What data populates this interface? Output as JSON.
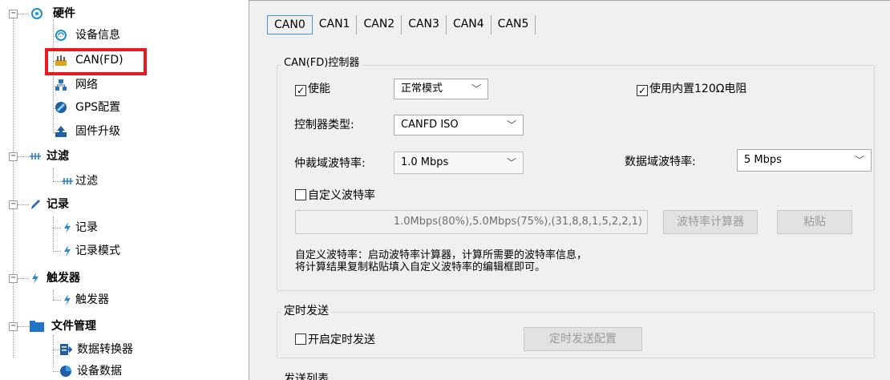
{
  "tree": {
    "nodes": [
      {
        "label": "硬件",
        "icon": "hardware-icon"
      },
      {
        "label": "设备信息",
        "icon": "device-info-icon"
      },
      {
        "label": "CAN(FD)",
        "icon": "can-icon"
      },
      {
        "label": "网络",
        "icon": "network-icon"
      },
      {
        "label": "GPS配置",
        "icon": "gps-icon"
      },
      {
        "label": "固件升级",
        "icon": "firmware-upgrade-icon"
      },
      {
        "label": "过滤",
        "icon": "filter-icon"
      },
      {
        "label": "过滤",
        "icon": "filter-icon"
      },
      {
        "label": "记录",
        "icon": "pencil-icon"
      },
      {
        "label": "记录",
        "icon": "lightning-icon"
      },
      {
        "label": "记录模式",
        "icon": "lightning-icon"
      },
      {
        "label": "触发器",
        "icon": "lightning-icon"
      },
      {
        "label": "触发器",
        "icon": "lightning-icon"
      },
      {
        "label": "文件管理",
        "icon": "folder-icon"
      },
      {
        "label": "数据转换器",
        "icon": "data-converter-icon"
      },
      {
        "label": "设备数据",
        "icon": "device-data-icon"
      }
    ],
    "highlight_color": "#e8191f"
  },
  "tabs": [
    "CAN0",
    "CAN1",
    "CAN2",
    "CAN3",
    "CAN4",
    "CAN5"
  ],
  "controller": {
    "title": "CAN(FD)控制器",
    "enable_label": "使能",
    "mode_value": "正常模式",
    "resistor_label": "使用内置120Ω电阻",
    "type_label": "控制器类型:",
    "type_value": "CANFD ISO",
    "arb_label": "仲裁域波特率:",
    "arb_value": "1.0 Mbps",
    "data_label": "数据域波特率:",
    "data_value": "5 Mbps",
    "custom_label": "自定义波特率",
    "custom_value": "1.0Mbps(80%),5.0Mbps(75%),(31,8,8,1,5,2,2,1)",
    "calc_button": "波特率计算器",
    "paste_button": "粘贴",
    "note_line1": "自定义波特率：启动波特率计算器，计算所需要的波特率信息，",
    "note_line2": "将计算结果复制粘贴填入自定义波特率的编辑框即可。"
  },
  "timer": {
    "title": "定时发送",
    "enable_label": "开启定时发送",
    "config_button": "定时发送配置"
  },
  "next_group_title": "发送列表"
}
